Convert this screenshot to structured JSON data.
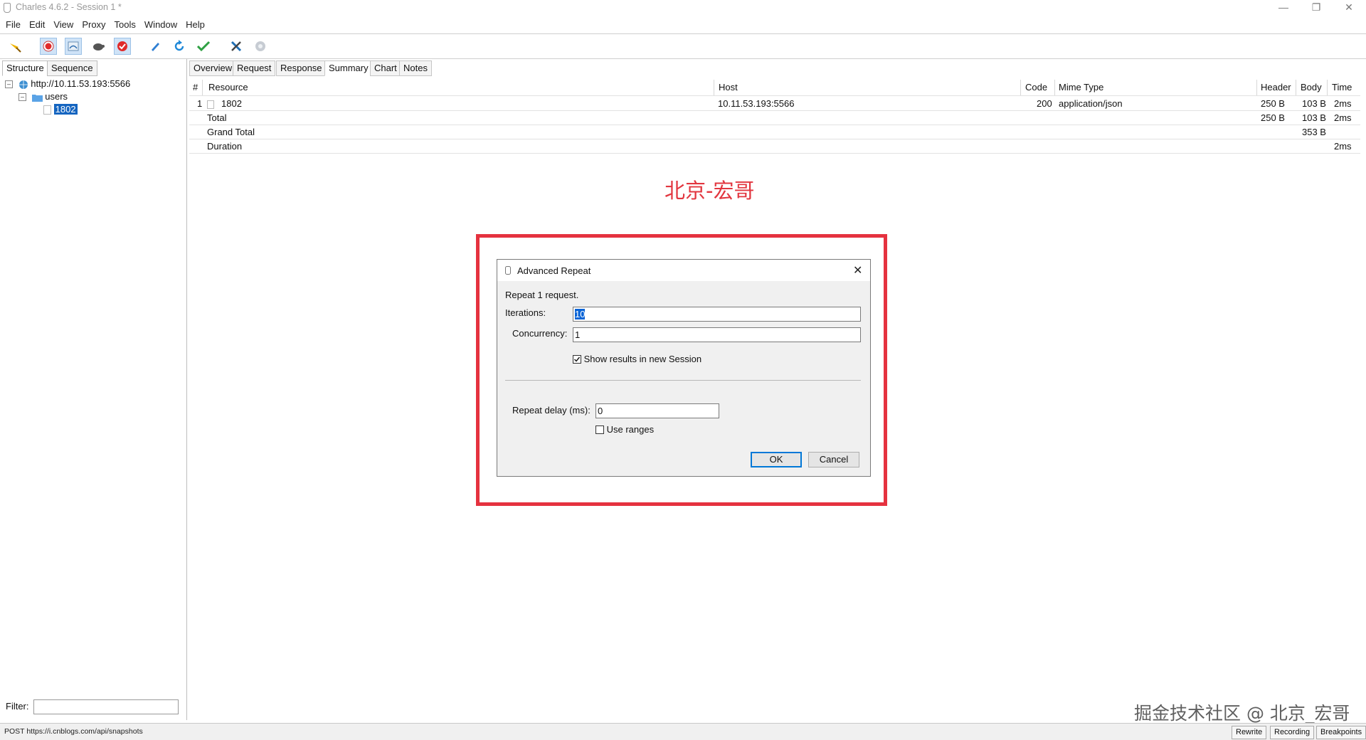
{
  "window": {
    "title": "Charles 4.6.2 - Session 1 *"
  },
  "menubar": [
    "File",
    "Edit",
    "View",
    "Proxy",
    "Tools",
    "Window",
    "Help"
  ],
  "toolbar": {
    "buttons": [
      "broom-icon",
      "record-icon",
      "throttle-icon",
      "turtle-icon",
      "stop-icon",
      "pen-icon",
      "repeat-icon",
      "validate-icon",
      "tools-icon",
      "settings-icon"
    ]
  },
  "left_panel": {
    "tabs": [
      "Structure",
      "Sequence"
    ],
    "tree": {
      "host": "http://10.11.53.193:5566",
      "folder": "users",
      "leaf": "1802"
    },
    "filter_label": "Filter:",
    "filter_value": ""
  },
  "right_panel": {
    "tabs": [
      "Overview",
      "Request",
      "Response",
      "Summary",
      "Chart",
      "Notes"
    ],
    "selected_tab": "Summary",
    "table": {
      "headers": [
        "#",
        "Resource",
        "Host",
        "Code",
        "Mime Type",
        "Header",
        "Body",
        "Time"
      ],
      "rows": [
        {
          "num": "1",
          "resource": "1802",
          "host": "10.11.53.193:5566",
          "code": "200",
          "mime": "application/json",
          "header": "250 B",
          "body": "103 B",
          "time": "2ms"
        },
        {
          "num": "",
          "resource": "Total",
          "host": "",
          "code": "",
          "mime": "",
          "header": "250 B",
          "body": "103 B",
          "time": "2ms"
        },
        {
          "num": "",
          "resource": "Grand Total",
          "host": "",
          "code": "",
          "mime": "",
          "header": "",
          "body": "353 B",
          "time": ""
        },
        {
          "num": "",
          "resource": "Duration",
          "host": "",
          "code": "",
          "mime": "",
          "header": "",
          "body": "",
          "time": "2ms"
        }
      ]
    }
  },
  "annotation": {
    "title": "北京-宏哥",
    "highlight_color": "#e5323f"
  },
  "dialog": {
    "title": "Advanced Repeat",
    "description": "Repeat 1 request.",
    "iterations_label": "Iterations:",
    "iterations_value": "10",
    "concurrency_label": "Concurrency:",
    "concurrency_value": "1",
    "show_results_label": "Show results in new Session",
    "show_results_checked": true,
    "repeat_delay_label": "Repeat delay (ms):",
    "repeat_delay_value": "0",
    "use_ranges_label": "Use ranges",
    "use_ranges_checked": false,
    "ok_label": "OK",
    "cancel_label": "Cancel"
  },
  "statusbar": {
    "text": "POST https://i.cnblogs.com/api/snapshots",
    "buttons": [
      "Rewrite",
      "Recording",
      "Breakpoints"
    ]
  },
  "watermark": "掘金技术社区 @ 北京_宏哥"
}
